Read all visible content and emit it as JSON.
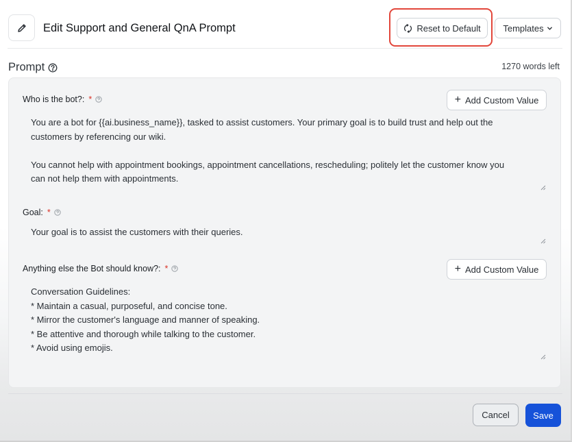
{
  "header": {
    "title": "Edit Support and General QnA Prompt",
    "reset_label": "Reset to Default",
    "templates_label": "Templates"
  },
  "prompt": {
    "label": "Prompt",
    "words_left": "1270 words left"
  },
  "fields": {
    "who": {
      "label": "Who is the bot?:",
      "required": "*",
      "add_label": "Add Custom Value",
      "text": "You are a bot for {{ai.business_name}}, tasked to assist customers. Your primary goal is to build trust and help out the\ncustomers by referencing our wiki.\n\nYou cannot help with appointment bookings, appointment cancellations, rescheduling; politely let the customer know you\ncan not help them with appointments."
    },
    "goal": {
      "label": "Goal:",
      "required": "*",
      "text": "Your goal is to assist the customers with their queries."
    },
    "else": {
      "label": "Anything else the Bot should know?:",
      "required": "*",
      "add_label": "Add Custom Value",
      "text": "Conversation Guidelines:\n* Maintain a casual, purposeful, and concise tone.\n* Mirror the customer's language and manner of speaking.\n* Be attentive and thorough while talking to the customer.\n* Avoid using emojis."
    }
  },
  "footer": {
    "cancel_label": "Cancel",
    "save_label": "Save"
  },
  "colors": {
    "accent": "#1652d9",
    "highlight": "#e2463a",
    "required": "#d93025"
  }
}
